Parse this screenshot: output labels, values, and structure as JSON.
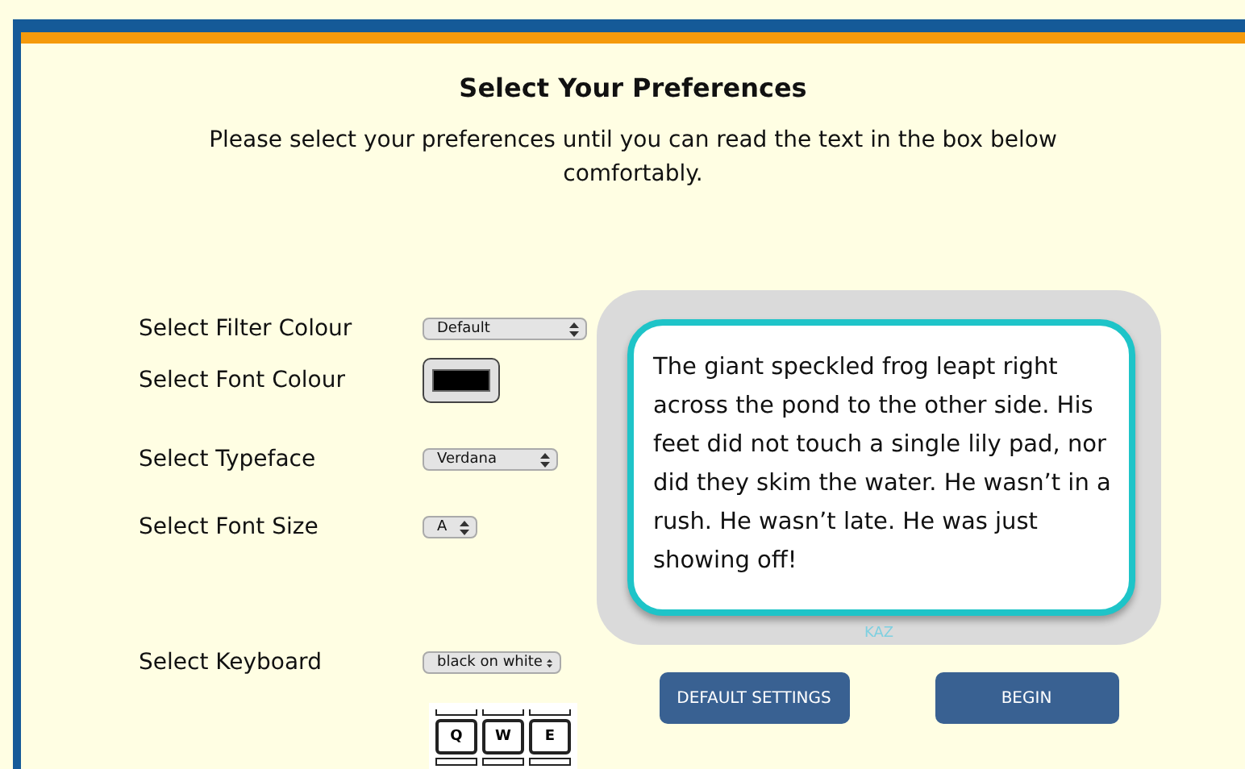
{
  "title": "Select Your Preferences",
  "intro": "Please select your preferences until you can read the text in the box below comfortably.",
  "settings": [
    {
      "kind": "select",
      "label": "Select Filter Colour",
      "value": "Default"
    },
    {
      "kind": "colour",
      "label": "Select Font Colour",
      "color": "#000000"
    },
    {
      "kind": "select",
      "label": "Select Typeface",
      "value": "Verdana"
    },
    {
      "kind": "select",
      "label": "Select Font Size",
      "value": "A"
    },
    {
      "kind": "select",
      "label": "Select Keyboard",
      "value": "black on white"
    }
  ],
  "keyboard_preview": {
    "keys": [
      "Q",
      "W",
      "E"
    ]
  },
  "sample_text": "The giant speckled frog leapt right across the pond to the other side. His feet did not touch a single lily pad, nor did they skim the water. He wasn’t in a rush. He wasn’t late. He was just showing off!",
  "credit": "KAZ",
  "buttons": [
    "DEFAULT SETTINGS",
    "BEGIN"
  ]
}
